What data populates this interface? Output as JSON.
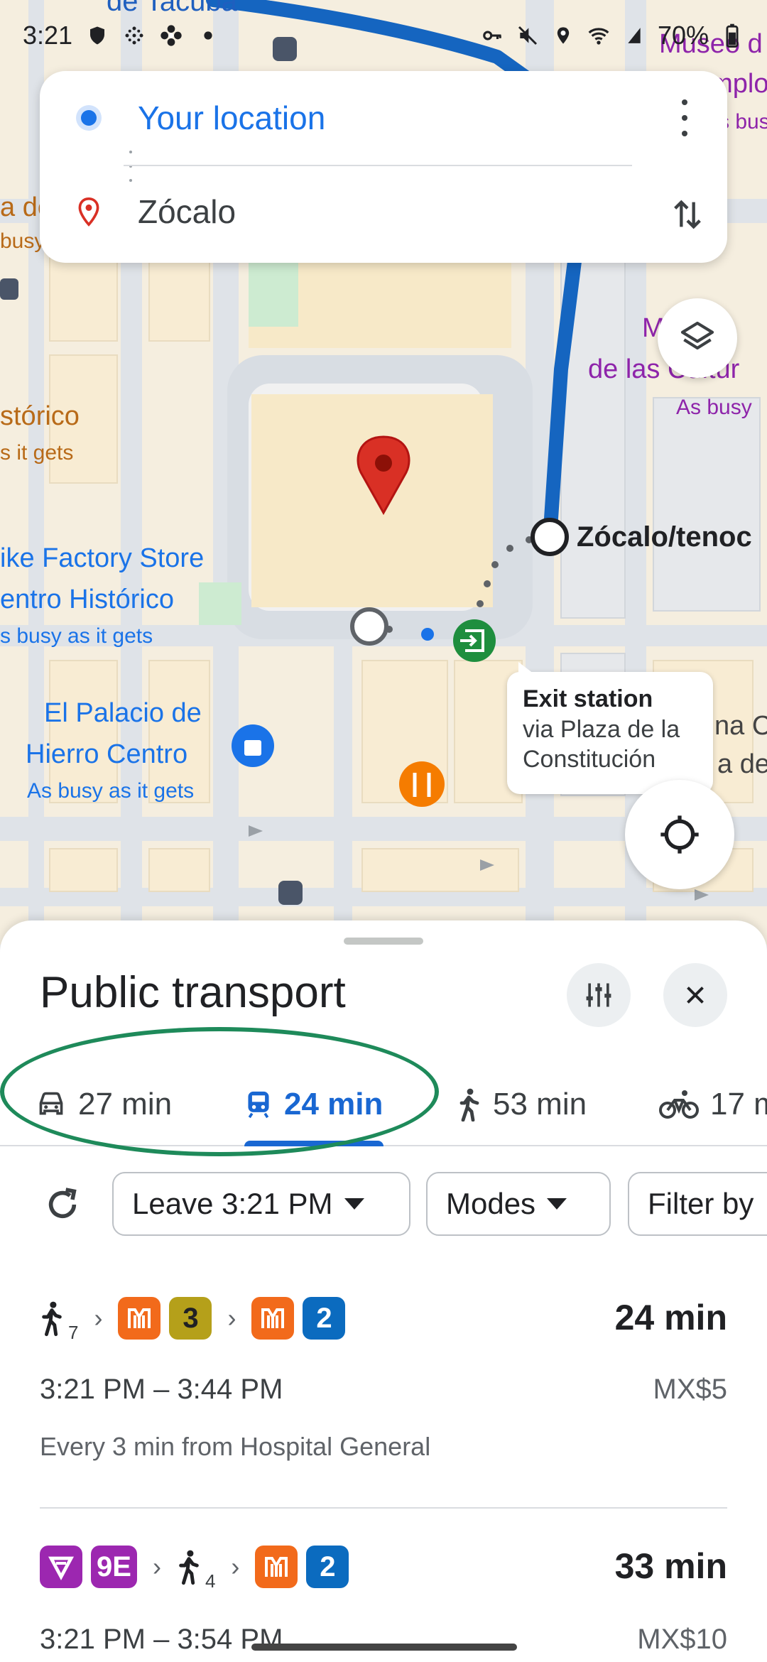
{
  "status_bar": {
    "time": "3:21",
    "battery": "70%"
  },
  "search": {
    "origin": "Your location",
    "destination": "Zócalo"
  },
  "map": {
    "labels": {
      "street_top": "de Tacuba",
      "museum_line1": "Museo d",
      "museum_line2": "Templo",
      "museum_busy": "As busy a",
      "left_busy_fragment": "busy",
      "left_orange_fragment": "a de",
      "centro_historico": "stórico",
      "centro_busy": "s it gets",
      "nike_line1": "ike Factory Store",
      "nike_line2": "entro Histórico",
      "nike_busy": "s busy as it gets",
      "museo_culturas_line1": "M      N",
      "museo_culturas_line2": "de las Cultur",
      "museo_culturas_busy": "As busy",
      "station": "Zócalo/tenoc",
      "palacio_line1": "El Palacio de",
      "palacio_line2": "Hierro Centro",
      "palacio_busy": "As busy as it gets",
      "right_fragment1": "na C",
      "right_fragment2": "a de"
    },
    "callout": {
      "title": "Exit station",
      "subtitle_line1": "via Plaza de la",
      "subtitle_line2": "Constitución"
    }
  },
  "sheet": {
    "title": "Public transport",
    "modes": [
      {
        "name": "drive",
        "icon": "car-icon",
        "label": "27 min",
        "active": false
      },
      {
        "name": "transit",
        "icon": "train-icon",
        "label": "24 min",
        "active": true
      },
      {
        "name": "walk",
        "icon": "walk-icon",
        "label": "53 min",
        "active": false
      },
      {
        "name": "bike",
        "icon": "bike-icon",
        "label": "17 m",
        "active": false
      }
    ],
    "filters": {
      "leave": "Leave 3:21 PM",
      "modes": "Modes",
      "filter_by": "Filter by"
    },
    "routes": [
      {
        "walk_minutes": "7",
        "lines": [
          "3",
          "2"
        ],
        "duration": "24 min",
        "times": "3:21 PM – 3:44 PM",
        "price": "MX$5",
        "frequency": "Every 3 min from Hospital General"
      },
      {
        "bus_line": "9E",
        "walk_minutes": "4",
        "lines": [
          "2"
        ],
        "duration": "33 min",
        "times": "3:21 PM – 3:54 PM",
        "price": "MX$10"
      }
    ]
  },
  "colors": {
    "route_blue": "#1565c0",
    "accent": "#1967d2",
    "metro_orange": "#f26a1b",
    "line3": "#b5a01a",
    "line2": "#0b6bbf",
    "metrobus_purple": "#9c27b0",
    "annotation_green": "#1e8a5a",
    "pin_red": "#d93025",
    "exit_green": "#1e8e3e"
  }
}
